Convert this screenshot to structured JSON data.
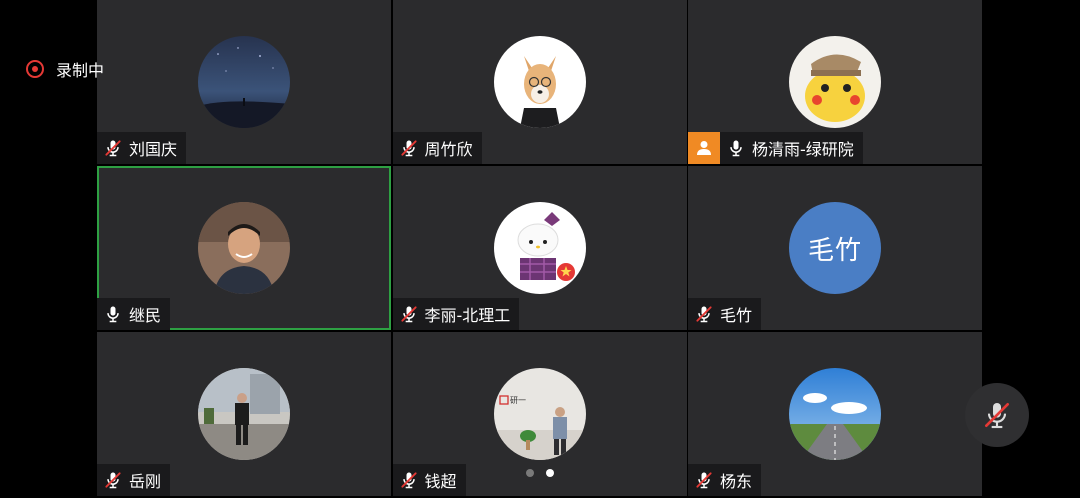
{
  "recording": {
    "label": "录制中",
    "color": "#e53935"
  },
  "participants": [
    {
      "name": "刘国庆",
      "mic": "muted",
      "avatar": "night-sky-photo"
    },
    {
      "name": "周竹欣",
      "mic": "muted",
      "avatar": "shiba-dog-glasses-photo"
    },
    {
      "name": "杨清雨-绿研院",
      "mic": "on",
      "host": true,
      "avatar": "pikachu-detective-photo"
    },
    {
      "name": "继民",
      "mic": "on",
      "active": true,
      "avatar": "man-portrait-photo"
    },
    {
      "name": "李丽-北理工",
      "mic": "muted",
      "avatar": "hello-kitty-photo"
    },
    {
      "name": "毛竹",
      "mic": "muted",
      "avatar_text": "毛竹"
    },
    {
      "name": "岳刚",
      "mic": "muted",
      "avatar": "street-person-photo"
    },
    {
      "name": "钱超",
      "mic": "muted",
      "avatar": "office-person-photo",
      "sign_text": "研一"
    },
    {
      "name": "杨东",
      "mic": "muted",
      "avatar": "highway-sky-photo"
    }
  ],
  "pagination": {
    "pages": 2,
    "current": 2
  },
  "self_mic": {
    "state": "muted"
  },
  "colors": {
    "tile_bg": "#2b2b2d",
    "active_border": "#2ea043",
    "host_badge": "#f08a24",
    "text_avatar_bg": "#4a7ec5",
    "mute_slash": "#e53935"
  }
}
